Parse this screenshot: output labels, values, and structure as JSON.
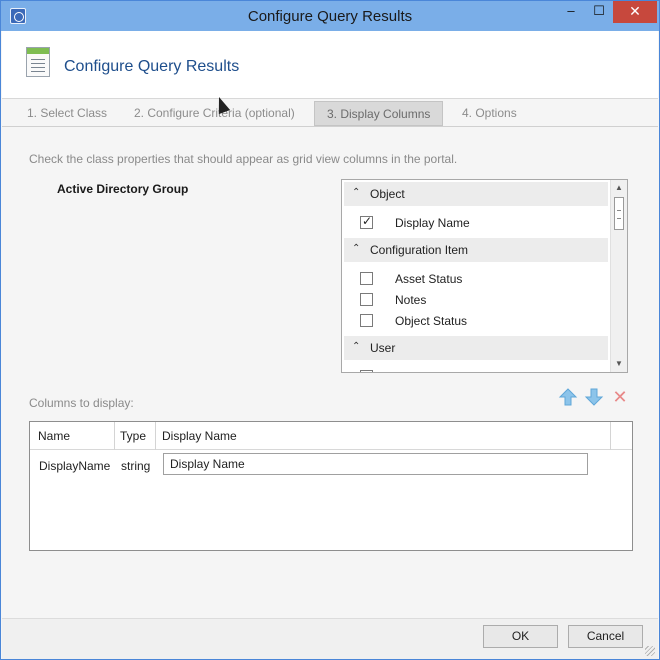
{
  "window": {
    "title": "Configure Query Results",
    "minimize": "–",
    "maximize": "☐",
    "close": "✕"
  },
  "header": {
    "title": "Configure Query Results"
  },
  "tabs": [
    {
      "label": "1. Select Class"
    },
    {
      "label": "2. Configure Criteria (optional)"
    },
    {
      "label": "3. Display Columns"
    },
    {
      "label": "4. Options"
    }
  ],
  "content": {
    "instructions": "Check the class properties that should appear as grid view columns in the portal.",
    "class_name": "Active Directory Group"
  },
  "properties": {
    "groups": [
      {
        "label": "Object",
        "items": [
          {
            "label": "Display Name",
            "checked": true
          }
        ]
      },
      {
        "label": "Configuration Item",
        "items": [
          {
            "label": "Asset Status",
            "checked": false
          },
          {
            "label": "Notes",
            "checked": false
          },
          {
            "label": "Object Status",
            "checked": false
          }
        ]
      },
      {
        "label": "User",
        "items": []
      }
    ]
  },
  "columns": {
    "label": "Columns to display:",
    "headers": {
      "name": "Name",
      "type": "Type",
      "display": "Display Name"
    },
    "rows": [
      {
        "name": "DisplayName",
        "type": "string",
        "display_name": "Display Name"
      }
    ]
  },
  "footer": {
    "ok": "OK",
    "cancel": "Cancel"
  }
}
